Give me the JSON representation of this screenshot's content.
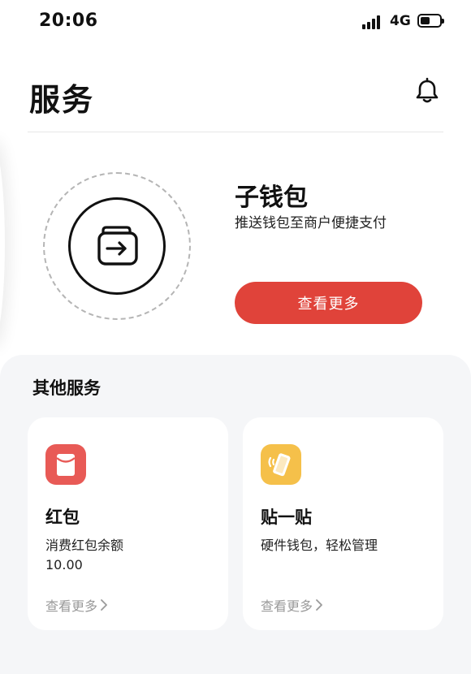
{
  "status_bar": {
    "time": "20:06",
    "network": "4G",
    "battery_level": 0.5
  },
  "header": {
    "title": "服务",
    "icons": [
      "bell-icon"
    ]
  },
  "sub_wallet": {
    "title": "子钱包",
    "description": "推送钱包至商户便捷支付",
    "button_label": "查看更多",
    "icon": "wallet-transfer-icon",
    "accent_color": "#e0433a"
  },
  "other_services": {
    "section_title": "其他服务",
    "cards": [
      {
        "title": "红包",
        "description": "消费红包余额",
        "amount": "10.00",
        "more_label": "查看更多",
        "icon": "red-envelope-icon",
        "icon_color": "#e85a56"
      },
      {
        "title": "贴一贴",
        "description": "硬件钱包，轻松管理",
        "more_label": "查看更多",
        "icon": "tap-phone-icon",
        "icon_color": "#f5c04a"
      }
    ]
  }
}
